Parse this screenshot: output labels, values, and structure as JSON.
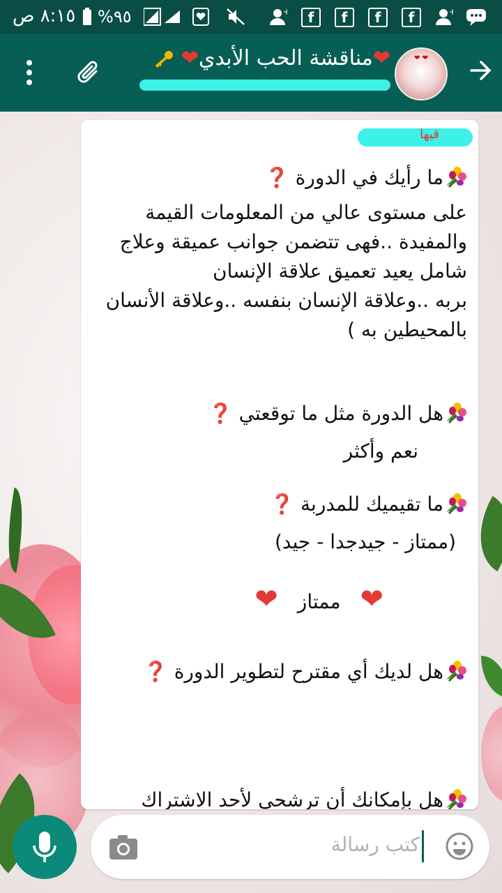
{
  "status_bar": {
    "time": "٨:١٥ ص",
    "battery": "%٩٥"
  },
  "header": {
    "title": "مناقشة الحب الأبدي",
    "icons": [
      "back-arrow-icon",
      "key-icon",
      "heart-icon",
      "attach-icon",
      "more-vert-icon"
    ]
  },
  "message": {
    "lines": [
      {
        "text": "ما رأيك في الدورة ",
        "q": "❓",
        "bouquet": true
      },
      {
        "text": "على مستوى عالي من المعلومات القيمة"
      },
      {
        "text": "والمفيدة ..فهى تتضمن جوانب عميقة وعلاج"
      },
      {
        "text": "شامل يعيد تعميق علاقة الإنسان"
      },
      {
        "text": "بربه ..وعلاقة الإنسان بنفسه ..وعلاقة الأنسان"
      },
      {
        "text": "بالمحيطين به )"
      },
      {
        "text": "هل الدورة مثل ما توقعتي ",
        "q": "❓",
        "bouquet": true
      },
      {
        "text": "نعم وأكثر"
      },
      {
        "text": "ما تقيميك للمدربة ",
        "q": "❓",
        "bouquet": true
      },
      {
        "text": "(ممتاز - جيدجدا - جيد)"
      },
      {
        "text": "ممتاز"
      },
      {
        "text": "هل لديك أي مقترح لتطوير الدورة ",
        "q": "❓",
        "bouquet": true
      },
      {
        "text": "هل بإمكانك أن ترشحي لأحد الاشتراك",
        "bouquet": true
      }
    ]
  },
  "input": {
    "placeholder": "كتب رسالة"
  },
  "colors": {
    "status_bar": "#0a4d45",
    "app_bar": "#075e54",
    "mic_button": "#0b8a79",
    "question_mark": "#e53935",
    "highlight": "#3df0e8"
  }
}
